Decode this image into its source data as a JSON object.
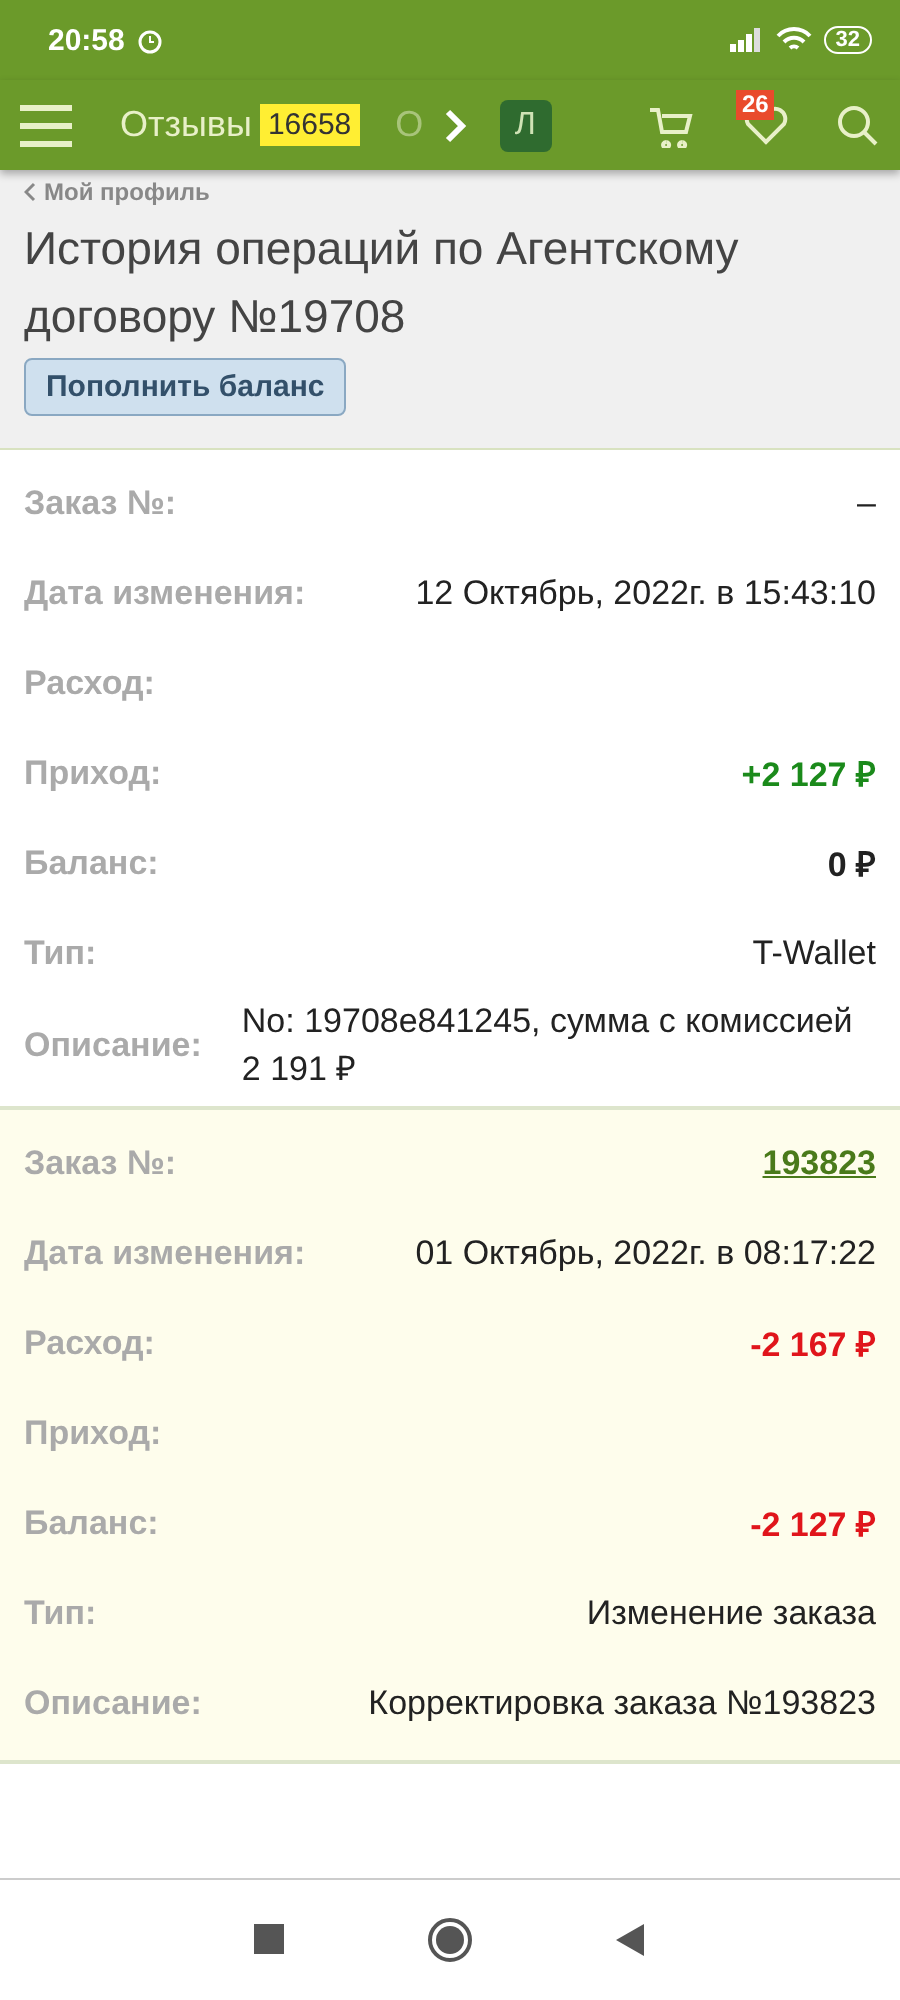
{
  "status_bar": {
    "time": "20:58",
    "battery": "32"
  },
  "header": {
    "tab_label": "Отзывы",
    "tab_count": "16658",
    "next_tab_fragment": "О",
    "avatar_letter": "Л",
    "favorites_count": "26"
  },
  "breadcrumb": "Мой профиль",
  "page_title": "История операций по Агентскому договору №19708",
  "topup_button": "Пополнить баланс",
  "records": [
    {
      "highlighted": false,
      "fields": [
        {
          "label": "Заказ №:",
          "value": "–",
          "kind": "plain"
        },
        {
          "label": "Дата изменения:",
          "value": "12 Октябрь, 2022г. в 15:43:10",
          "kind": "plain"
        },
        {
          "label": "Расход:"
        },
        {
          "label": "Приход:",
          "value": "+2 127 ₽",
          "kind": "positive"
        },
        {
          "label": "Баланс:",
          "value": "0 ₽",
          "kind": "bold"
        },
        {
          "label": "Тип:",
          "value": "T-Wallet",
          "kind": "plain"
        },
        {
          "label": "Описание:",
          "value": "No: 19708e841245, сумма с комиссией 2 191 ₽",
          "kind": "text"
        }
      ]
    },
    {
      "highlighted": true,
      "fields": [
        {
          "label": "Заказ №:",
          "value": "193823",
          "kind": "link"
        },
        {
          "label": "Дата изменения:",
          "value": "01 Октябрь, 2022г. в 08:17:22",
          "kind": "plain"
        },
        {
          "label": "Расход:",
          "value": "-2 167 ₽",
          "kind": "negative"
        },
        {
          "label": "Приход:"
        },
        {
          "label": "Баланс:",
          "value": "-2 127 ₽",
          "kind": "negative"
        },
        {
          "label": "Тип:",
          "value": "Изменение заказа",
          "kind": "plain"
        },
        {
          "label": "Описание:",
          "value": "Корректировка заказа №193823",
          "kind": "plain"
        }
      ]
    }
  ]
}
